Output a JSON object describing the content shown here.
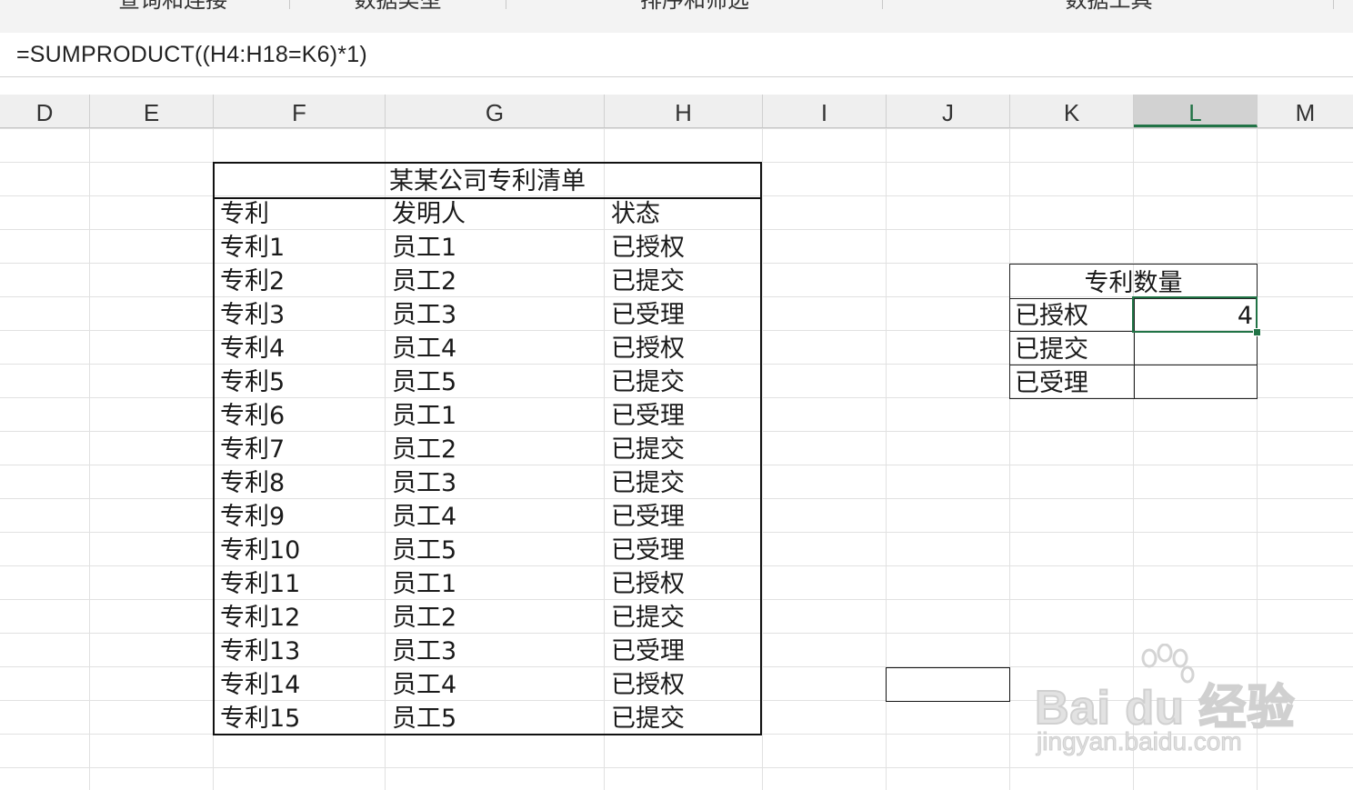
{
  "ribbon": {
    "groups": [
      {
        "label": "查询和连接"
      },
      {
        "label": "数据类型"
      },
      {
        "label": "排序和筛选"
      },
      {
        "label": "数据工具"
      }
    ]
  },
  "formula_bar": {
    "formula": "=SUMPRODUCT((H4:H18=K6)*1)"
  },
  "columns": [
    {
      "label": "D"
    },
    {
      "label": "E"
    },
    {
      "label": "F"
    },
    {
      "label": "G"
    },
    {
      "label": "H"
    },
    {
      "label": "I"
    },
    {
      "label": "J"
    },
    {
      "label": "K"
    },
    {
      "label": "L",
      "active": true
    },
    {
      "label": "M"
    }
  ],
  "patent_table": {
    "title": "某某公司专利清单",
    "headers": [
      "专利",
      "发明人",
      "状态"
    ],
    "rows": [
      [
        "专利1",
        "员工1",
        "已授权"
      ],
      [
        "专利2",
        "员工2",
        "已提交"
      ],
      [
        "专利3",
        "员工3",
        "已受理"
      ],
      [
        "专利4",
        "员工4",
        "已授权"
      ],
      [
        "专利5",
        "员工5",
        "已提交"
      ],
      [
        "专利6",
        "员工1",
        "已受理"
      ],
      [
        "专利7",
        "员工2",
        "已提交"
      ],
      [
        "专利8",
        "员工3",
        "已提交"
      ],
      [
        "专利9",
        "员工4",
        "已受理"
      ],
      [
        "专利10",
        "员工5",
        "已受理"
      ],
      [
        "专利11",
        "员工1",
        "已授权"
      ],
      [
        "专利12",
        "员工2",
        "已提交"
      ],
      [
        "专利13",
        "员工3",
        "已受理"
      ],
      [
        "专利14",
        "员工4",
        "已授权"
      ],
      [
        "专利15",
        "员工5",
        "已提交"
      ]
    ]
  },
  "summary_table": {
    "title": "专利数量",
    "rows": [
      {
        "label": "已授权",
        "value": "4"
      },
      {
        "label": "已提交",
        "value": ""
      },
      {
        "label": "已受理",
        "value": ""
      }
    ]
  },
  "colors": {
    "selection": "#217346",
    "header_bg": "#efefef",
    "gridline": "#e1e1e1"
  },
  "watermark": {
    "logo_text": "Bai du 经验",
    "url": "jingyan.baidu.com"
  }
}
